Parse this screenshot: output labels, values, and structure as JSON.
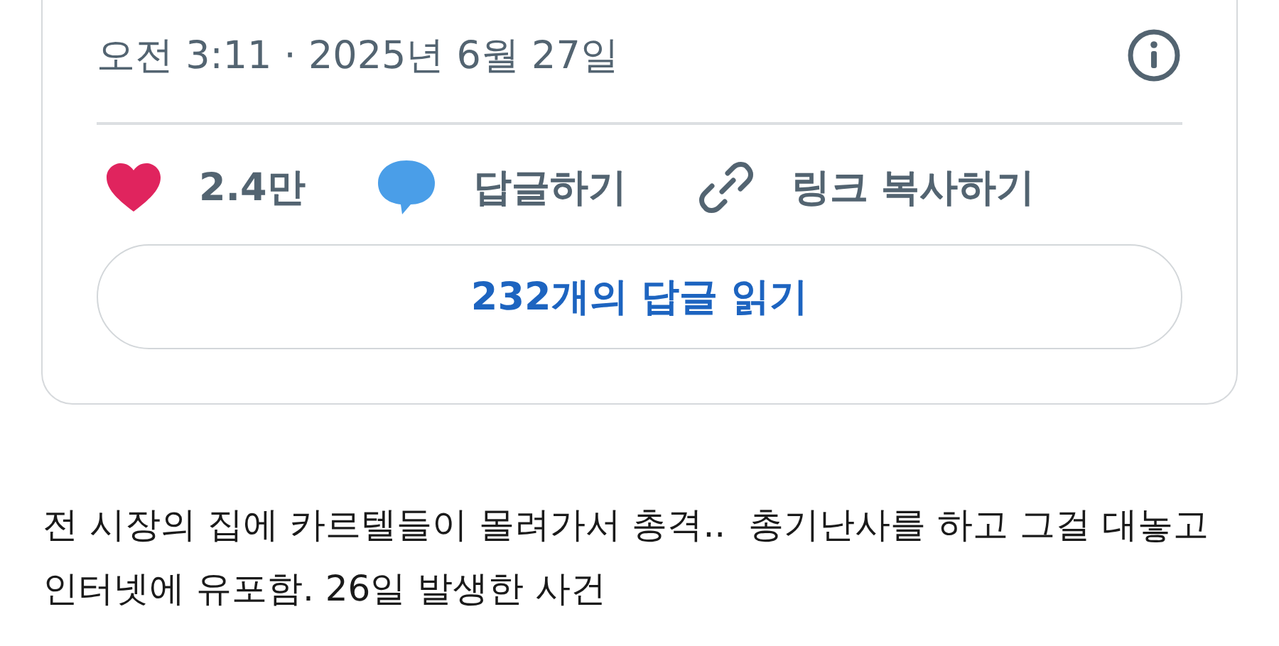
{
  "tweet_card": {
    "timestamp": "오전 3:11 · 2025년 6월 27일",
    "actions": [
      {
        "kind": "like",
        "label": "2.4만"
      },
      {
        "kind": "reply",
        "label": "답글하기"
      },
      {
        "kind": "copy_link",
        "label": "링크 복사하기"
      }
    ],
    "read_replies_button": "232개의 답글 읽기"
  },
  "post_text": "전 시장의 집에 카르텔들이 몰려가서 총격..  총기난사를 하고 그걸 대놓고 인터넷에 유포함. 26일 발생한 사건"
}
